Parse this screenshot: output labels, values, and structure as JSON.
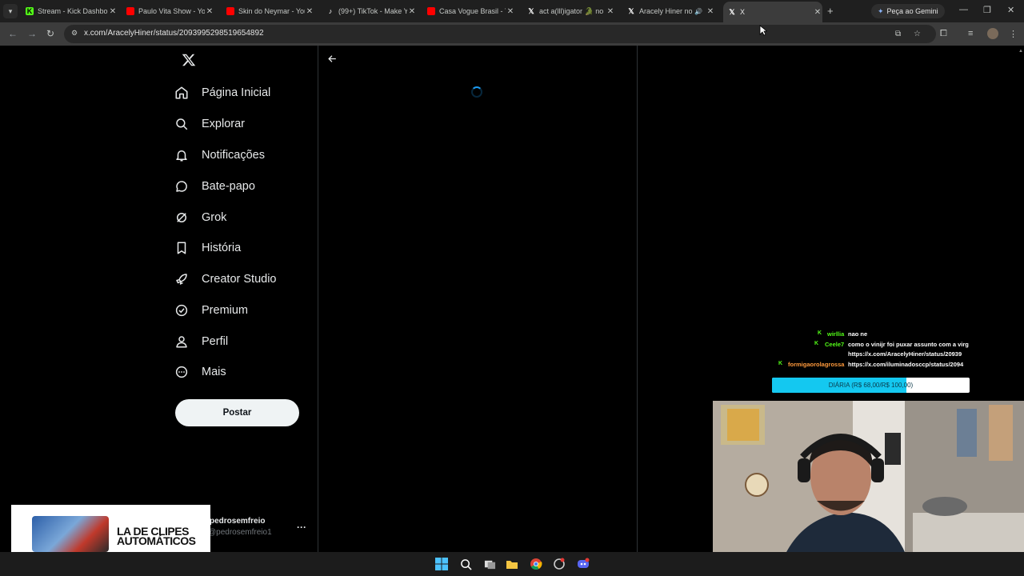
{
  "browser": {
    "tabs": [
      {
        "title": "Stream - Kick Dashbo",
        "favicon": "kick-icon"
      },
      {
        "title": "Paulo Vita Show - Yo",
        "favicon": "youtube-icon"
      },
      {
        "title": "Skin do Neymar - You",
        "favicon": "youtube-icon"
      },
      {
        "title": "(99+) TikTok - Make Y",
        "favicon": "tiktok-icon"
      },
      {
        "title": "Casa Vogue Brasil - Yo",
        "favicon": "youtube-icon"
      },
      {
        "title": "act a(lll)igator 🐊 no",
        "favicon": "x-icon"
      },
      {
        "title": "Aracely Hiner no X",
        "favicon": "x-icon"
      },
      {
        "title": "X",
        "favicon": "x-icon",
        "active": true
      }
    ],
    "gemini_label": "Peça ao Gemini",
    "url": "x.com/AracelyHiner/status/2093995298519654892"
  },
  "sidebar": {
    "logo": "X",
    "items": [
      {
        "label": "Página Inicial",
        "icon": "home-icon"
      },
      {
        "label": "Explorar",
        "icon": "search-icon"
      },
      {
        "label": "Notificações",
        "icon": "bell-icon"
      },
      {
        "label": "Bate-papo",
        "icon": "chat-bubble-icon"
      },
      {
        "label": "Grok",
        "icon": "grok-icon"
      },
      {
        "label": "História",
        "icon": "bookmark-icon"
      },
      {
        "label": "Creator Studio",
        "icon": "rocket-icon"
      },
      {
        "label": "Premium",
        "icon": "verified-badge-icon"
      },
      {
        "label": "Perfil",
        "icon": "person-icon"
      },
      {
        "label": "Mais",
        "icon": "more-circle-icon"
      }
    ],
    "post_label": "Postar",
    "account": {
      "name": "pedrosemfreio",
      "handle": "@pedrosemfreio1",
      "more": "···"
    }
  },
  "overlay": {
    "chat": [
      {
        "user": "wirllia",
        "message": "nao ne",
        "color": "#53fc18"
      },
      {
        "user": "Ceele7",
        "message": "como o vinijr foi puxar assunto com a virg",
        "color": "#53fc18"
      },
      {
        "user": "",
        "message": "https://x.com/AracelyHiner/status/20939",
        "color": "#ffffff"
      },
      {
        "user": "formigaorolagrossa",
        "message": "https://x.com/iluminadosccp/status/2094",
        "color": "#ff9a3c"
      }
    ],
    "goal": {
      "label": "DIÁRIA (R$ 68,00/R$ 100,00)",
      "progress": 0.68
    },
    "promo_text": "LA DE CLIPES AUTOMÁTICOS"
  },
  "colors": {
    "accent": "#1d9bf0",
    "kick_green": "#53fc18",
    "goal_fill": "#14c8f0"
  }
}
